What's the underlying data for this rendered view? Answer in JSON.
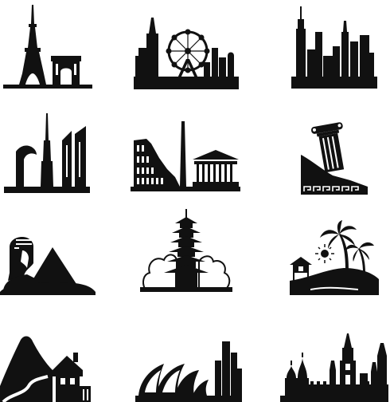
{
  "icon_set": {
    "ink_color": "#111111",
    "paper_color": "#ffffff",
    "icons": [
      {
        "name": "paris-eiffel-tower-arc-icon"
      },
      {
        "name": "london-big-ben-eye-icon"
      },
      {
        "name": "new-york-skyline-icon"
      },
      {
        "name": "dubai-skyline-icon"
      },
      {
        "name": "rome-colosseum-obelisk-icon"
      },
      {
        "name": "greek-column-ruins-icon"
      },
      {
        "name": "egypt-sphinx-pyramid-icon"
      },
      {
        "name": "asian-pagoda-icon"
      },
      {
        "name": "tropical-palm-beach-icon"
      },
      {
        "name": "mountain-chalet-icon"
      },
      {
        "name": "sydney-opera-house-icon"
      },
      {
        "name": "moscow-kremlin-icon"
      }
    ]
  }
}
